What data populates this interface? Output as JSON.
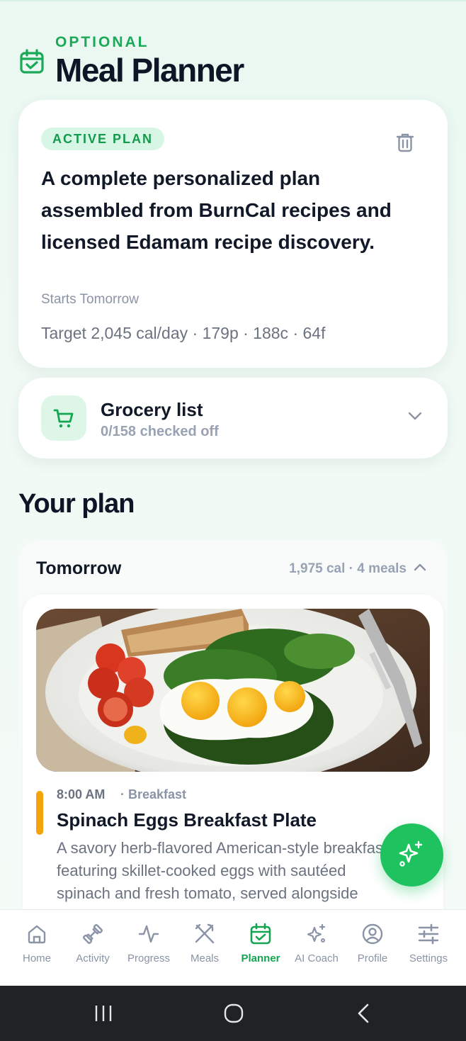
{
  "header": {
    "eyebrow": "OPTIONAL",
    "title": "Meal Planner",
    "icon": "calendar-check-icon"
  },
  "plan": {
    "badge": "ACTIVE PLAN",
    "description": "A complete personalized plan assembled from BurnCal recipes and licensed Edamam recipe discovery.",
    "starts": "Starts Tomorrow",
    "target": "Target 2,045 cal/day · 179p · 188c · 64f",
    "delete_icon": "trash-icon"
  },
  "grocery": {
    "title": "Grocery list",
    "subtitle": "0/158 checked off",
    "icon": "cart-icon"
  },
  "your_plan": {
    "title": "Your plan",
    "day": {
      "label": "Tomorrow",
      "meta": "1,975 cal · 4 meals",
      "meal": {
        "time": "8:00 AM",
        "type": "· Breakfast",
        "title": "Spinach Eggs Breakfast Plate",
        "description": "A savory herb-flavored American-style breakfast featuring skillet-cooked eggs with sautéed spinach and fresh tomato, served alongside"
      }
    }
  },
  "nav": {
    "items": [
      {
        "label": "Home",
        "icon": "home-icon"
      },
      {
        "label": "Activity",
        "icon": "dumbbell-icon"
      },
      {
        "label": "Progress",
        "icon": "activity-line-icon"
      },
      {
        "label": "Meals",
        "icon": "utensils-icon"
      },
      {
        "label": "Planner",
        "icon": "calendar-check-icon"
      },
      {
        "label": "AI Coach",
        "icon": "sparkles-icon"
      },
      {
        "label": "Profile",
        "icon": "user-circle-icon"
      },
      {
        "label": "Settings",
        "icon": "sliders-icon"
      }
    ],
    "active": "Planner"
  },
  "colors": {
    "brand_green": "#1ec25f",
    "accent_orange": "#f5a30b",
    "badge_bg": "#d8f6e5"
  }
}
